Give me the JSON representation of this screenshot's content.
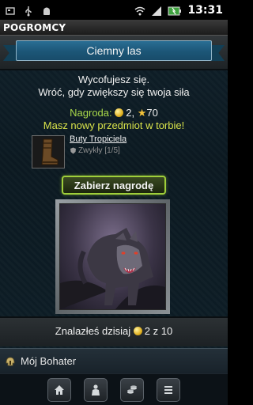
{
  "status_bar": {
    "time": "13:31",
    "left_icons": [
      "notification-icon",
      "usb-icon",
      "android-icon"
    ],
    "right_icons": [
      "wifi-icon",
      "signal-icon",
      "battery-icon"
    ]
  },
  "app": {
    "title": "POGROMCY"
  },
  "location": {
    "title": "Ciemny las"
  },
  "result": {
    "line1": "Wycofujesz się.",
    "line2": "Wróć, gdy zwiększy się twoja siła"
  },
  "reward": {
    "label": "Nagroda:",
    "gold": "2",
    "separator": ",",
    "xp": "70",
    "new_item_text": "Masz nowy przedmiot w torbie!"
  },
  "item": {
    "name": "Buty Tropiciela",
    "rarity": "Zwykły [1/5]"
  },
  "claim_button": {
    "label": "Zabierz nagrodę"
  },
  "found_today": {
    "label": "Znalazłeś dzisiaj",
    "count": "2 z 10"
  },
  "hero_bar": {
    "label": "Mój Bohater"
  },
  "nav": {
    "items": [
      "home-icon",
      "character-icon",
      "coins-icon",
      "menu-icon"
    ]
  },
  "colors": {
    "banner_blue": "#1c5677",
    "accent_green": "#9fcf3a",
    "reward_green": "#a9d84a",
    "item_yellow": "#d8e24a",
    "background": "#0c1a22"
  }
}
